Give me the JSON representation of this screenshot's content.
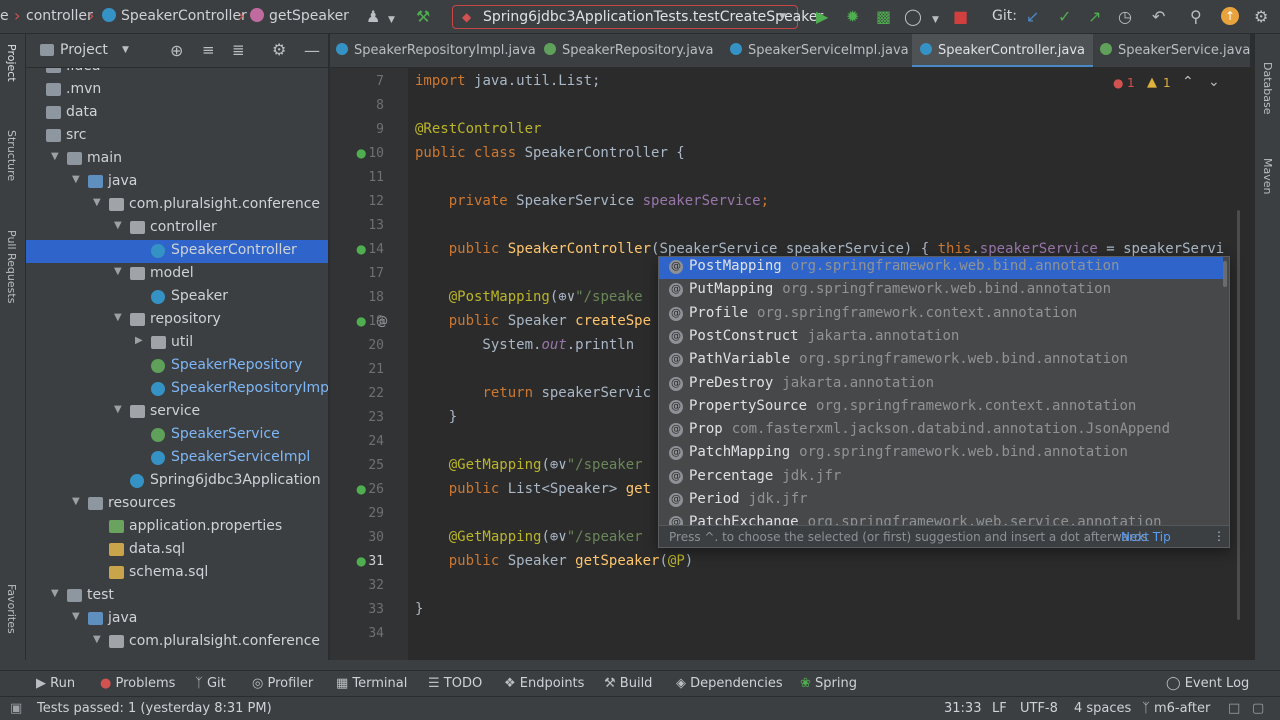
{
  "breadcrumbs": [
    "e",
    "controller",
    "SpeakerController",
    "getSpeaker"
  ],
  "run_config": "Spring6jdbc3ApplicationTests.testCreateSpeaker",
  "git_label": "Git:",
  "project_panel": {
    "title": "Project"
  },
  "tree": [
    {
      "label": ".idea",
      "kind": "folder",
      "indent": 0
    },
    {
      "label": ".mvn",
      "kind": "folder",
      "indent": 0
    },
    {
      "label": "data",
      "kind": "folder",
      "indent": 0
    },
    {
      "label": "src",
      "kind": "folder",
      "indent": 0
    },
    {
      "label": "main",
      "kind": "folder",
      "indent": 1,
      "expanded": true
    },
    {
      "label": "java",
      "kind": "folder-src",
      "indent": 2,
      "expanded": true
    },
    {
      "label": "com.pluralsight.conference",
      "kind": "pkg",
      "indent": 3,
      "expanded": true
    },
    {
      "label": "controller",
      "kind": "pkg",
      "indent": 4,
      "expanded": true
    },
    {
      "label": "SpeakerController",
      "kind": "cls",
      "indent": 5,
      "selected": true
    },
    {
      "label": "model",
      "kind": "pkg",
      "indent": 4,
      "expanded": true
    },
    {
      "label": "Speaker",
      "kind": "cls",
      "indent": 5
    },
    {
      "label": "repository",
      "kind": "pkg",
      "indent": 4,
      "expanded": true
    },
    {
      "label": "util",
      "kind": "pkg",
      "indent": 5,
      "collapsed": true
    },
    {
      "label": "SpeakerRepository",
      "kind": "ifc",
      "indent": 5,
      "vcs": true
    },
    {
      "label": "SpeakerRepositoryImpl",
      "kind": "cls",
      "indent": 5,
      "vcs": true
    },
    {
      "label": "service",
      "kind": "pkg",
      "indent": 4,
      "expanded": true
    },
    {
      "label": "SpeakerService",
      "kind": "ifc",
      "indent": 5,
      "vcs": true
    },
    {
      "label": "SpeakerServiceImpl",
      "kind": "cls",
      "indent": 5,
      "vcs": true
    },
    {
      "label": "Spring6jdbc3Application",
      "kind": "cls",
      "indent": 4
    },
    {
      "label": "resources",
      "kind": "folder",
      "indent": 2,
      "expanded": true
    },
    {
      "label": "application.properties",
      "kind": "props",
      "indent": 3
    },
    {
      "label": "data.sql",
      "kind": "sql",
      "indent": 3
    },
    {
      "label": "schema.sql",
      "kind": "sql",
      "indent": 3
    },
    {
      "label": "test",
      "kind": "folder",
      "indent": 1,
      "expanded": true
    },
    {
      "label": "java",
      "kind": "folder-src",
      "indent": 2,
      "expanded": true
    },
    {
      "label": "com.pluralsight.conference",
      "kind": "pkg",
      "indent": 3,
      "expanded": true
    }
  ],
  "tabs": [
    {
      "label": "SpeakerRepositoryImpl.java",
      "kind": "cls"
    },
    {
      "label": "SpeakerRepository.java",
      "kind": "ifc"
    },
    {
      "label": "SpeakerServiceImpl.java",
      "kind": "cls"
    },
    {
      "label": "SpeakerController.java",
      "kind": "cls",
      "active": true
    },
    {
      "label": "SpeakerService.java",
      "kind": "ifc"
    }
  ],
  "inspection": {
    "errors": "1",
    "warnings": "1"
  },
  "line_numbers": [
    "7",
    "8",
    "9",
    "10",
    "11",
    "12",
    "13",
    "14",
    "17",
    "18",
    "19",
    "20",
    "21",
    "22",
    "23",
    "24",
    "25",
    "26",
    "29",
    "30",
    "31",
    "32",
    "33",
    "34"
  ],
  "code_lines": [
    [
      [
        "kw",
        "import "
      ],
      [
        "p",
        "java.util.List;"
      ]
    ],
    [],
    [
      [
        "an",
        "@RestController"
      ]
    ],
    [
      [
        "kw",
        "public class "
      ],
      [
        "p",
        "SpeakerController {"
      ]
    ],
    [],
    [
      [
        "p",
        "    "
      ],
      [
        "kw",
        "private "
      ],
      [
        "p",
        "SpeakerService "
      ],
      [
        "fld",
        "speakerService"
      ],
      [
        "kw",
        ";"
      ]
    ],
    [],
    [
      [
        "p",
        "    "
      ],
      [
        "kw",
        "public "
      ],
      [
        "fn",
        "SpeakerController"
      ],
      [
        "p",
        "(SpeakerService speakerService) { "
      ],
      [
        "kw",
        "this"
      ],
      [
        "p",
        "."
      ],
      [
        "fld",
        "speakerService"
      ],
      [
        "p",
        " = speakerServi"
      ]
    ],
    [],
    [
      [
        "p",
        "    "
      ],
      [
        "an",
        "@PostMapping"
      ],
      [
        "p",
        "(⊕∨"
      ],
      [
        "str",
        "\"/speake"
      ]
    ],
    [
      [
        "p",
        "    "
      ],
      [
        "kw",
        "public "
      ],
      [
        "p",
        "Speaker "
      ],
      [
        "fn",
        "createSpe"
      ]
    ],
    [
      [
        "p",
        "        System."
      ],
      [
        "fld",
        "out"
      ],
      [
        "p",
        ".println"
      ]
    ],
    [],
    [
      [
        "p",
        "        "
      ],
      [
        "kw",
        "return "
      ],
      [
        "p",
        "speakerServic"
      ]
    ],
    [
      [
        "p",
        "    }"
      ]
    ],
    [],
    [
      [
        "p",
        "    "
      ],
      [
        "an",
        "@GetMapping"
      ],
      [
        "p",
        "(⊕∨"
      ],
      [
        "str",
        "\"/speaker"
      ]
    ],
    [
      [
        "p",
        "    "
      ],
      [
        "kw",
        "public "
      ],
      [
        "p",
        "List<Speaker> "
      ],
      [
        "fn",
        "get"
      ]
    ],
    [],
    [
      [
        "p",
        "    "
      ],
      [
        "an",
        "@GetMapping"
      ],
      [
        "p",
        "(⊕∨"
      ],
      [
        "str",
        "\"/speaker"
      ]
    ],
    [
      [
        "p",
        "    "
      ],
      [
        "kw",
        "public "
      ],
      [
        "p",
        "Speaker "
      ],
      [
        "fn",
        "getSpeaker"
      ],
      [
        "p",
        "("
      ],
      [
        "an",
        "@P"
      ],
      [
        "p",
        ")"
      ]
    ],
    [],
    [
      [
        "p",
        "}"
      ]
    ],
    []
  ],
  "suggestions": [
    {
      "name": "PostMapping",
      "pkg": "org.springframework.web.bind.annotation",
      "selected": true
    },
    {
      "name": "PutMapping",
      "pkg": "org.springframework.web.bind.annotation"
    },
    {
      "name": "Profile",
      "pkg": "org.springframework.context.annotation"
    },
    {
      "name": "PostConstruct",
      "pkg": "jakarta.annotation"
    },
    {
      "name": "PathVariable",
      "pkg": "org.springframework.web.bind.annotation"
    },
    {
      "name": "PreDestroy",
      "pkg": "jakarta.annotation"
    },
    {
      "name": "PropertySource",
      "pkg": "org.springframework.context.annotation"
    },
    {
      "name": "Prop",
      "pkg": "com.fasterxml.jackson.databind.annotation.JsonAppend"
    },
    {
      "name": "PatchMapping",
      "pkg": "org.springframework.web.bind.annotation"
    },
    {
      "name": "Percentage",
      "pkg": "jdk.jfr"
    },
    {
      "name": "Period",
      "pkg": "jdk.jfr"
    },
    {
      "name": "PatchExchange",
      "pkg": "org.springframework.web.service.annotation"
    }
  ],
  "popup_footer": {
    "hint": "Press ^. to choose the selected (or first) suggestion and insert a dot afterwards",
    "next_tip": "Next Tip"
  },
  "tool_windows": [
    "Run",
    "Problems",
    "Git",
    "Profiler",
    "Terminal",
    "TODO",
    "Endpoints",
    "Build",
    "Dependencies",
    "Spring"
  ],
  "event_log": "Event Log",
  "status": {
    "message": "Tests passed: 1 (yesterday 8:31 PM)",
    "position": "31:33",
    "line_sep": "LF",
    "encoding": "UTF-8",
    "indent": "4 spaces",
    "branch": "m6-after"
  },
  "side_labels": {
    "project": "Project",
    "structure": "Structure",
    "pull_requests": "Pull Requests",
    "favorites": "Favorites",
    "database": "Database",
    "maven": "Maven"
  },
  "colors": {
    "accent": "#2f65ca",
    "error": "#c74646",
    "run": "#4fae4f"
  }
}
